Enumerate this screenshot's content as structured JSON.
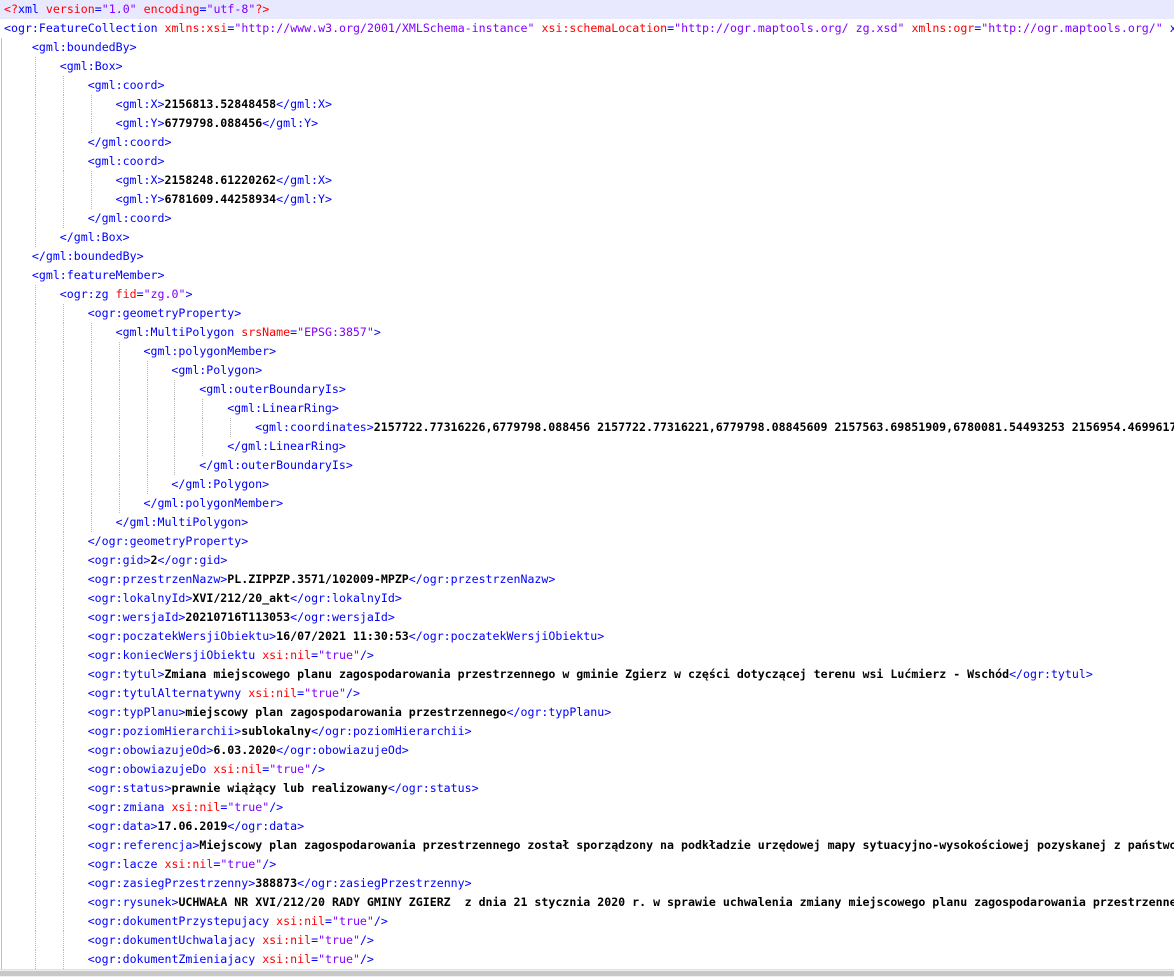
{
  "lines": [
    {
      "indent": 0,
      "parts": [
        [
          "pi",
          "<?"
        ],
        [
          "t",
          "xml "
        ],
        [
          "a",
          "version"
        ],
        [
          "t",
          "="
        ],
        [
          "v",
          "\"1.0\""
        ],
        [
          "t",
          " "
        ],
        [
          "a",
          "encoding"
        ],
        [
          "t",
          "="
        ],
        [
          "v",
          "\"utf-8\""
        ],
        [
          "pi",
          "?>"
        ]
      ]
    },
    {
      "indent": 0,
      "parts": [
        [
          "t",
          "<ogr:FeatureCollection "
        ],
        [
          "a",
          "xmlns:xsi"
        ],
        [
          "t",
          "="
        ],
        [
          "v",
          "\"http://www.w3.org/2001/XMLSchema-instance\""
        ],
        [
          "t",
          " "
        ],
        [
          "a",
          "xsi:schemaLocation"
        ],
        [
          "t",
          "="
        ],
        [
          "v",
          "\"http://ogr.maptools.org/ zg.xsd\""
        ],
        [
          "t",
          " "
        ],
        [
          "a",
          "xmlns:ogr"
        ],
        [
          "t",
          "="
        ],
        [
          "v",
          "\"http://ogr.maptools.org/\""
        ],
        [
          "t",
          " x"
        ]
      ]
    },
    {
      "indent": 1,
      "parts": [
        [
          "t",
          "<gml:boundedBy>"
        ]
      ]
    },
    {
      "indent": 2,
      "parts": [
        [
          "t",
          "<gml:Box>"
        ]
      ]
    },
    {
      "indent": 3,
      "parts": [
        [
          "t",
          "<gml:coord>"
        ]
      ]
    },
    {
      "indent": 4,
      "parts": [
        [
          "t",
          "<gml:X>"
        ],
        [
          "x",
          "2156813.52848458"
        ],
        [
          "t",
          "</gml:X>"
        ]
      ]
    },
    {
      "indent": 4,
      "parts": [
        [
          "t",
          "<gml:Y>"
        ],
        [
          "x",
          "6779798.088456"
        ],
        [
          "t",
          "</gml:Y>"
        ]
      ]
    },
    {
      "indent": 3,
      "parts": [
        [
          "t",
          "</gml:coord>"
        ]
      ]
    },
    {
      "indent": 3,
      "parts": [
        [
          "t",
          "<gml:coord>"
        ]
      ]
    },
    {
      "indent": 4,
      "parts": [
        [
          "t",
          "<gml:X>"
        ],
        [
          "x",
          "2158248.61220262"
        ],
        [
          "t",
          "</gml:X>"
        ]
      ]
    },
    {
      "indent": 4,
      "parts": [
        [
          "t",
          "<gml:Y>"
        ],
        [
          "x",
          "6781609.44258934"
        ],
        [
          "t",
          "</gml:Y>"
        ]
      ]
    },
    {
      "indent": 3,
      "parts": [
        [
          "t",
          "</gml:coord>"
        ]
      ]
    },
    {
      "indent": 2,
      "parts": [
        [
          "t",
          "</gml:Box>"
        ]
      ]
    },
    {
      "indent": 1,
      "parts": [
        [
          "t",
          "</gml:boundedBy>"
        ]
      ]
    },
    {
      "indent": 1,
      "parts": [
        [
          "t",
          "<gml:featureMember>"
        ]
      ]
    },
    {
      "indent": 2,
      "parts": [
        [
          "t",
          "<ogr:zg "
        ],
        [
          "a",
          "fid"
        ],
        [
          "t",
          "="
        ],
        [
          "v",
          "\"zg.0\""
        ],
        [
          "t",
          ">"
        ]
      ]
    },
    {
      "indent": 3,
      "parts": [
        [
          "t",
          "<ogr:geometryProperty>"
        ]
      ]
    },
    {
      "indent": 4,
      "parts": [
        [
          "t",
          "<gml:MultiPolygon "
        ],
        [
          "a",
          "srsName"
        ],
        [
          "t",
          "="
        ],
        [
          "v",
          "\"EPSG:3857\""
        ],
        [
          "t",
          ">"
        ]
      ]
    },
    {
      "indent": 5,
      "parts": [
        [
          "t",
          "<gml:polygonMember>"
        ]
      ]
    },
    {
      "indent": 6,
      "parts": [
        [
          "t",
          "<gml:Polygon>"
        ]
      ]
    },
    {
      "indent": 7,
      "parts": [
        [
          "t",
          "<gml:outerBoundaryIs>"
        ]
      ]
    },
    {
      "indent": 8,
      "parts": [
        [
          "t",
          "<gml:LinearRing>"
        ]
      ]
    },
    {
      "indent": 9,
      "parts": [
        [
          "t",
          "<gml:coordinates>"
        ],
        [
          "x",
          "2157722.77316226,6779798.088456 2157722.77316221,6779798.08845609 2157563.69851909,6780081.54493253 2156954.4699617"
        ]
      ]
    },
    {
      "indent": 8,
      "parts": [
        [
          "t",
          "</gml:LinearRing>"
        ]
      ]
    },
    {
      "indent": 7,
      "parts": [
        [
          "t",
          "</gml:outerBoundaryIs>"
        ]
      ]
    },
    {
      "indent": 6,
      "parts": [
        [
          "t",
          "</gml:Polygon>"
        ]
      ]
    },
    {
      "indent": 5,
      "parts": [
        [
          "t",
          "</gml:polygonMember>"
        ]
      ]
    },
    {
      "indent": 4,
      "parts": [
        [
          "t",
          "</gml:MultiPolygon>"
        ]
      ]
    },
    {
      "indent": 3,
      "parts": [
        [
          "t",
          "</ogr:geometryProperty>"
        ]
      ]
    },
    {
      "indent": 3,
      "parts": [
        [
          "t",
          "<ogr:gid>"
        ],
        [
          "x",
          "2"
        ],
        [
          "t",
          "</ogr:gid>"
        ]
      ]
    },
    {
      "indent": 3,
      "parts": [
        [
          "t",
          "<ogr:przestrzenNazw>"
        ],
        [
          "x",
          "PL.ZIPPZP.3571/102009-MPZP"
        ],
        [
          "t",
          "</ogr:przestrzenNazw>"
        ]
      ]
    },
    {
      "indent": 3,
      "parts": [
        [
          "t",
          "<ogr:lokalnyId>"
        ],
        [
          "x",
          "XVI/212/20_akt"
        ],
        [
          "t",
          "</ogr:lokalnyId>"
        ]
      ]
    },
    {
      "indent": 3,
      "parts": [
        [
          "t",
          "<ogr:wersjaId>"
        ],
        [
          "x",
          "20210716T113053"
        ],
        [
          "t",
          "</ogr:wersjaId>"
        ]
      ]
    },
    {
      "indent": 3,
      "parts": [
        [
          "t",
          "<ogr:poczatekWersjiObiektu>"
        ],
        [
          "x",
          "16/07/2021 11:30:53"
        ],
        [
          "t",
          "</ogr:poczatekWersjiObiektu>"
        ]
      ]
    },
    {
      "indent": 3,
      "parts": [
        [
          "t",
          "<ogr:koniecWersjiObiektu "
        ],
        [
          "a",
          "xsi:nil"
        ],
        [
          "t",
          "="
        ],
        [
          "v",
          "\"true\""
        ],
        [
          "t",
          "/>"
        ]
      ]
    },
    {
      "indent": 3,
      "parts": [
        [
          "t",
          "<ogr:tytul>"
        ],
        [
          "x",
          "Zmiana miejscowego planu zagospodarowania przestrzennego w gminie Zgierz w części dotyczącej terenu wsi Lućmierz - Wschód"
        ],
        [
          "t",
          "</ogr:tytul>"
        ]
      ]
    },
    {
      "indent": 3,
      "parts": [
        [
          "t",
          "<ogr:tytulAlternatywny "
        ],
        [
          "a",
          "xsi:nil"
        ],
        [
          "t",
          "="
        ],
        [
          "v",
          "\"true\""
        ],
        [
          "t",
          "/>"
        ]
      ]
    },
    {
      "indent": 3,
      "parts": [
        [
          "t",
          "<ogr:typPlanu>"
        ],
        [
          "x",
          "miejscowy plan zagospodarowania przestrzennego"
        ],
        [
          "t",
          "</ogr:typPlanu>"
        ]
      ]
    },
    {
      "indent": 3,
      "parts": [
        [
          "t",
          "<ogr:poziomHierarchii>"
        ],
        [
          "x",
          "sublokalny"
        ],
        [
          "t",
          "</ogr:poziomHierarchii>"
        ]
      ]
    },
    {
      "indent": 3,
      "parts": [
        [
          "t",
          "<ogr:obowiazujeOd>"
        ],
        [
          "x",
          "6.03.2020"
        ],
        [
          "t",
          "</ogr:obowiazujeOd>"
        ]
      ]
    },
    {
      "indent": 3,
      "parts": [
        [
          "t",
          "<ogr:obowiazujeDo "
        ],
        [
          "a",
          "xsi:nil"
        ],
        [
          "t",
          "="
        ],
        [
          "v",
          "\"true\""
        ],
        [
          "t",
          "/>"
        ]
      ]
    },
    {
      "indent": 3,
      "parts": [
        [
          "t",
          "<ogr:status>"
        ],
        [
          "x",
          "prawnie wiążący lub realizowany"
        ],
        [
          "t",
          "</ogr:status>"
        ]
      ]
    },
    {
      "indent": 3,
      "parts": [
        [
          "t",
          "<ogr:zmiana "
        ],
        [
          "a",
          "xsi:nil"
        ],
        [
          "t",
          "="
        ],
        [
          "v",
          "\"true\""
        ],
        [
          "t",
          "/>"
        ]
      ]
    },
    {
      "indent": 3,
      "parts": [
        [
          "t",
          "<ogr:data>"
        ],
        [
          "x",
          "17.06.2019"
        ],
        [
          "t",
          "</ogr:data>"
        ]
      ]
    },
    {
      "indent": 3,
      "parts": [
        [
          "t",
          "<ogr:referencja>"
        ],
        [
          "x",
          "Miejscowy plan zagospodarowania przestrzennego został sporządzony na podkładzie urzędowej mapy sytuacyjno-wysokościowej pozyskanej z państwo"
        ]
      ]
    },
    {
      "indent": 3,
      "parts": [
        [
          "t",
          "<ogr:lacze "
        ],
        [
          "a",
          "xsi:nil"
        ],
        [
          "t",
          "="
        ],
        [
          "v",
          "\"true\""
        ],
        [
          "t",
          "/>"
        ]
      ]
    },
    {
      "indent": 3,
      "parts": [
        [
          "t",
          "<ogr:zasiegPrzestrzenny>"
        ],
        [
          "x",
          "388873"
        ],
        [
          "t",
          "</ogr:zasiegPrzestrzenny>"
        ]
      ]
    },
    {
      "indent": 3,
      "parts": [
        [
          "t",
          "<ogr:rysunek>"
        ],
        [
          "x",
          "UCHWAŁA NR XVI/212/20 RADY GMINY ZGIERZ  z dnia 21 stycznia 2020 r. w sprawie uchwalenia zmiany miejscowego planu zagospodarowania przestrzenne"
        ]
      ]
    },
    {
      "indent": 3,
      "parts": [
        [
          "t",
          "<ogr:dokumentPrzystepujacy "
        ],
        [
          "a",
          "xsi:nil"
        ],
        [
          "t",
          "="
        ],
        [
          "v",
          "\"true\""
        ],
        [
          "t",
          "/>"
        ]
      ]
    },
    {
      "indent": 3,
      "parts": [
        [
          "t",
          "<ogr:dokumentUchwalajacy "
        ],
        [
          "a",
          "xsi:nil"
        ],
        [
          "t",
          "="
        ],
        [
          "v",
          "\"true\""
        ],
        [
          "t",
          "/>"
        ]
      ]
    },
    {
      "indent": 3,
      "parts": [
        [
          "t",
          "<ogr:dokumentZmieniajacy "
        ],
        [
          "a",
          "xsi:nil"
        ],
        [
          "t",
          "="
        ],
        [
          "v",
          "\"true\""
        ],
        [
          "t",
          "/>"
        ]
      ]
    }
  ],
  "highlight_line": 0,
  "colors": {
    "tag": "#0000ff",
    "attribute": "#ff0000",
    "value": "#8000ff",
    "text": "#000000",
    "current_line": "#e8e8ff"
  }
}
